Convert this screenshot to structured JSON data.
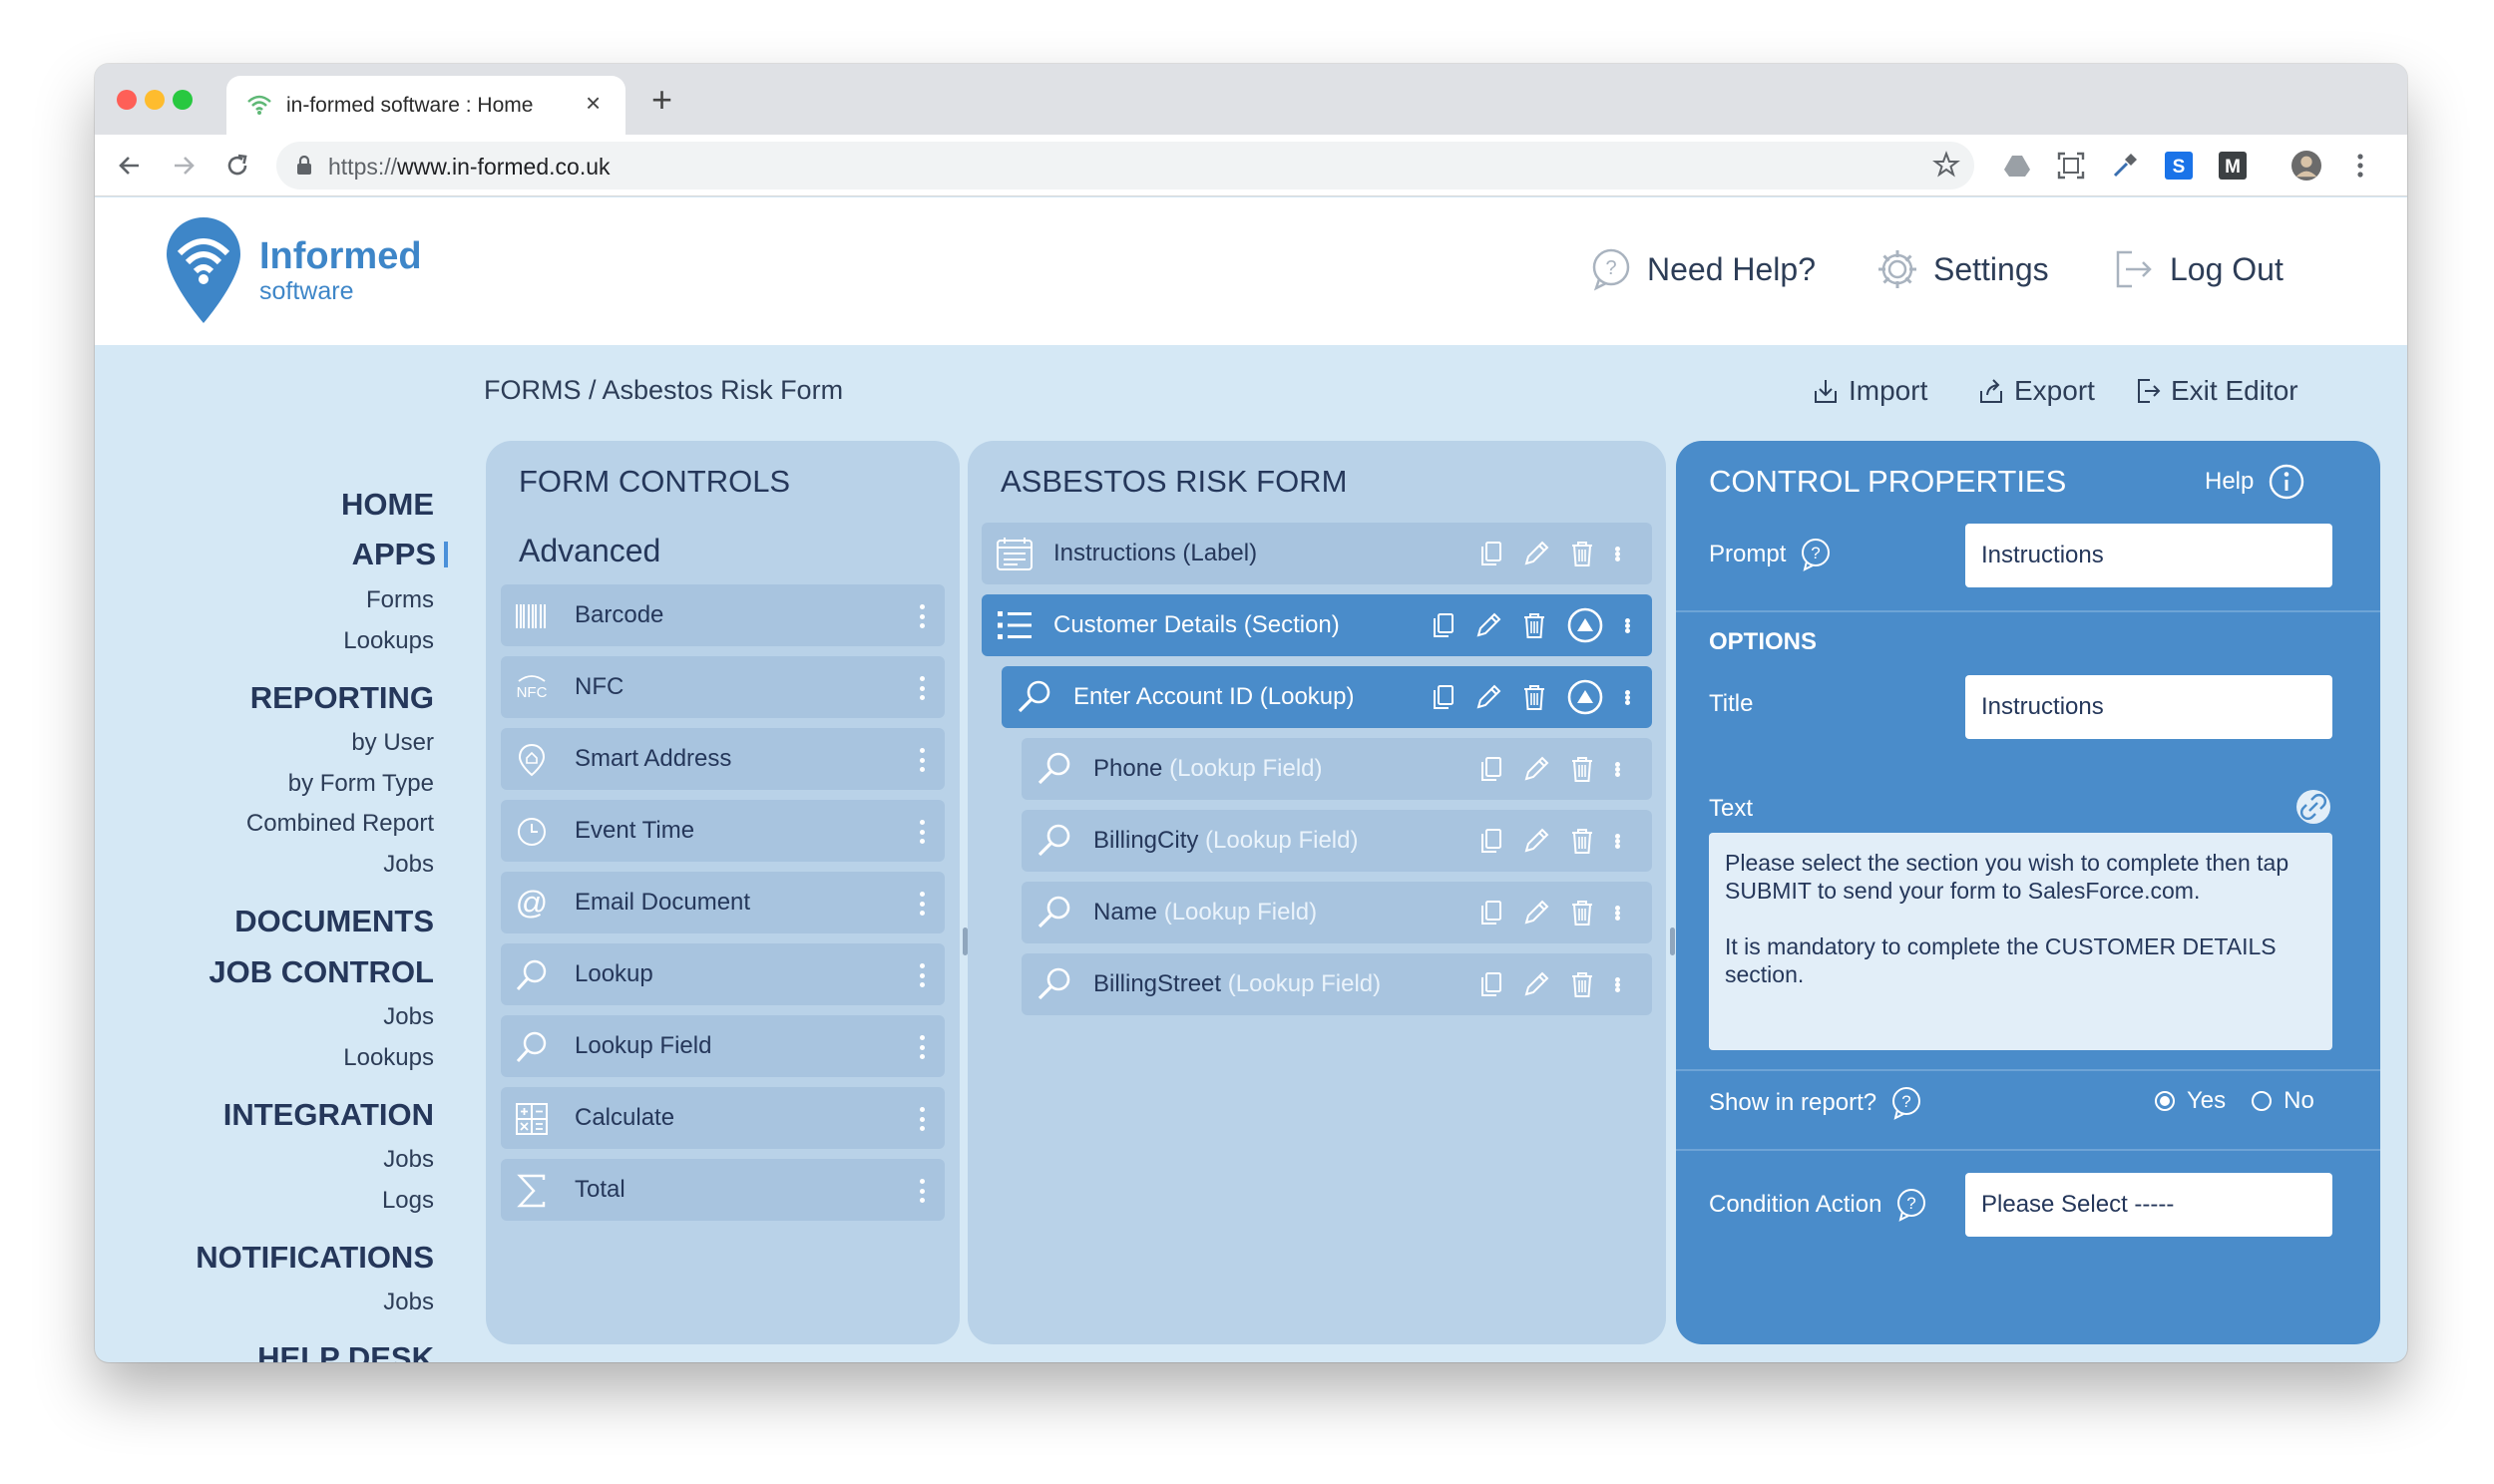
{
  "browser": {
    "tab_title": "in-formed software : Home",
    "url_scheme": "https://",
    "url_host": "www.in-formed.co.uk"
  },
  "header": {
    "logo_title": "Informed",
    "logo_subtitle": "software",
    "need_help": "Need Help?",
    "settings": "Settings",
    "logout": "Log Out"
  },
  "nav": {
    "home": "HOME",
    "apps": "APPS",
    "apps_forms": "Forms",
    "apps_lookups": "Lookups",
    "reporting": "REPORTING",
    "reporting_by_user": "by User",
    "reporting_by_form_type": "by Form Type",
    "reporting_combined": "Combined Report",
    "reporting_jobs": "Jobs",
    "documents": "DOCUMENTS",
    "job_control": "JOB CONTROL",
    "job_control_jobs": "Jobs",
    "job_control_lookups": "Lookups",
    "integration": "INTEGRATION",
    "integration_jobs": "Jobs",
    "integration_logs": "Logs",
    "notifications": "NOTIFICATIONS",
    "notifications_jobs": "Jobs",
    "help_desk": "HELP DESK"
  },
  "breadcrumb": "FORMS / Asbestos Risk Form",
  "actions": {
    "import": "Import",
    "export": "Export",
    "exit_editor": "Exit Editor"
  },
  "form_controls": {
    "title": "FORM CONTROLS",
    "section": "Advanced",
    "items": [
      {
        "label": "Barcode",
        "icon": "barcode-icon"
      },
      {
        "label": "NFC",
        "icon": "nfc-icon"
      },
      {
        "label": "Smart Address",
        "icon": "map-pin-icon"
      },
      {
        "label": "Event Time",
        "icon": "clock-icon"
      },
      {
        "label": "Email Document",
        "icon": "at-sign-icon"
      },
      {
        "label": "Lookup",
        "icon": "magnifier-icon"
      },
      {
        "label": "Lookup Field",
        "icon": "magnifier-icon"
      },
      {
        "label": "Calculate",
        "icon": "calculator-icon"
      },
      {
        "label": "Total",
        "icon": "sigma-icon"
      }
    ]
  },
  "form": {
    "title": "ASBESTOS RISK FORM",
    "items": [
      {
        "name": "Instructions",
        "type": "(Label)"
      },
      {
        "name": "Customer Details",
        "type": "(Section)"
      },
      {
        "name": "Enter Account ID",
        "type": "(Lookup)"
      },
      {
        "name": "Phone",
        "type": "(Lookup Field)"
      },
      {
        "name": "BillingCity",
        "type": "(Lookup Field)"
      },
      {
        "name": "Name",
        "type": "(Lookup Field)"
      },
      {
        "name": "BillingStreet",
        "type": "(Lookup Field)"
      }
    ]
  },
  "properties": {
    "title": "CONTROL PROPERTIES",
    "help": "Help",
    "prompt_label": "Prompt",
    "prompt_value": "Instructions",
    "options_header": "OPTIONS",
    "title_label": "Title",
    "title_value": "Instructions",
    "text_label": "Text",
    "text_value": "Please select the section you wish to complete then tap SUBMIT to send your form to SalesForce.com.\n\nIt is mandatory to complete the CUSTOMER DETAILS section.",
    "show_in_report_label": "Show in report?",
    "yes": "Yes",
    "no": "No",
    "condition_action_label": "Condition Action",
    "condition_action_value": "Please Select -----"
  },
  "colors": {
    "accent": "#4a8cca",
    "panel": "#b9d2e8",
    "page_bg": "#d5e8f5",
    "text_dark": "#25375a"
  }
}
